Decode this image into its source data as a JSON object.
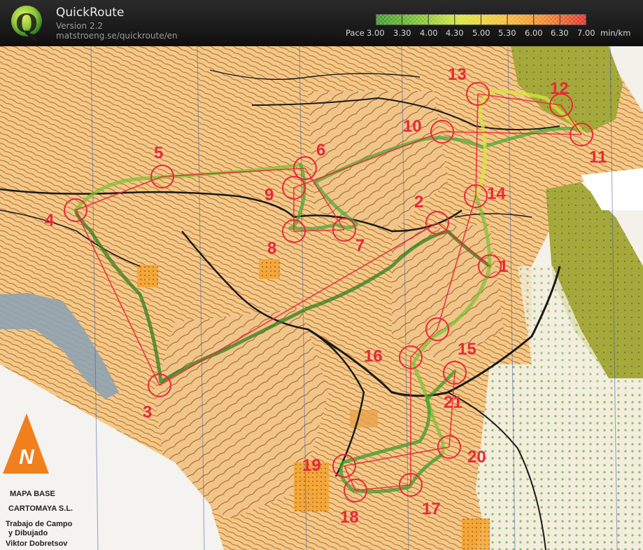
{
  "header": {
    "app_name": "QuickRoute",
    "version": "Version 2.2",
    "url": "matstroeng.se/quickroute/en",
    "logo_icon": "quickroute-logo-icon"
  },
  "pace_scale": {
    "label": "Pace",
    "ticks": [
      "3.00",
      "3.30",
      "4.00",
      "4.30",
      "5.00",
      "5.30",
      "6.00",
      "6.30",
      "7.00"
    ],
    "unit": "min/km",
    "colors": [
      "#3d9a2c",
      "#7ec234",
      "#d9e640",
      "#f4c23a",
      "#f28b2f",
      "#e5322b"
    ]
  },
  "map": {
    "credits": {
      "line1": "MAPA BASE",
      "line2": "CARTOMAYA S.L.",
      "line3": "Trabajo de Campo",
      "line4": "y Dibujado",
      "line5": "Viktor Dobretsov"
    },
    "controls": [
      {
        "label": "1"
      },
      {
        "label": "2"
      },
      {
        "label": "3"
      },
      {
        "label": "4"
      },
      {
        "label": "5"
      },
      {
        "label": "6"
      },
      {
        "label": "7"
      },
      {
        "label": "8"
      },
      {
        "label": "9"
      },
      {
        "label": "10"
      },
      {
        "label": "11"
      },
      {
        "label": "12"
      },
      {
        "label": "13"
      },
      {
        "label": "14"
      },
      {
        "label": "15"
      },
      {
        "label": "16"
      },
      {
        "label": "17"
      },
      {
        "label": "18"
      },
      {
        "label": "19"
      },
      {
        "label": "20"
      },
      {
        "label": "21"
      }
    ],
    "north_arrow_label": "N",
    "colors": {
      "terrain": "#f2c98a",
      "contour": "#b5651d",
      "course": "#e8283b",
      "water": "#8fa3b3",
      "buildings": "#a5a83a",
      "road": "#1a1a1a"
    }
  }
}
